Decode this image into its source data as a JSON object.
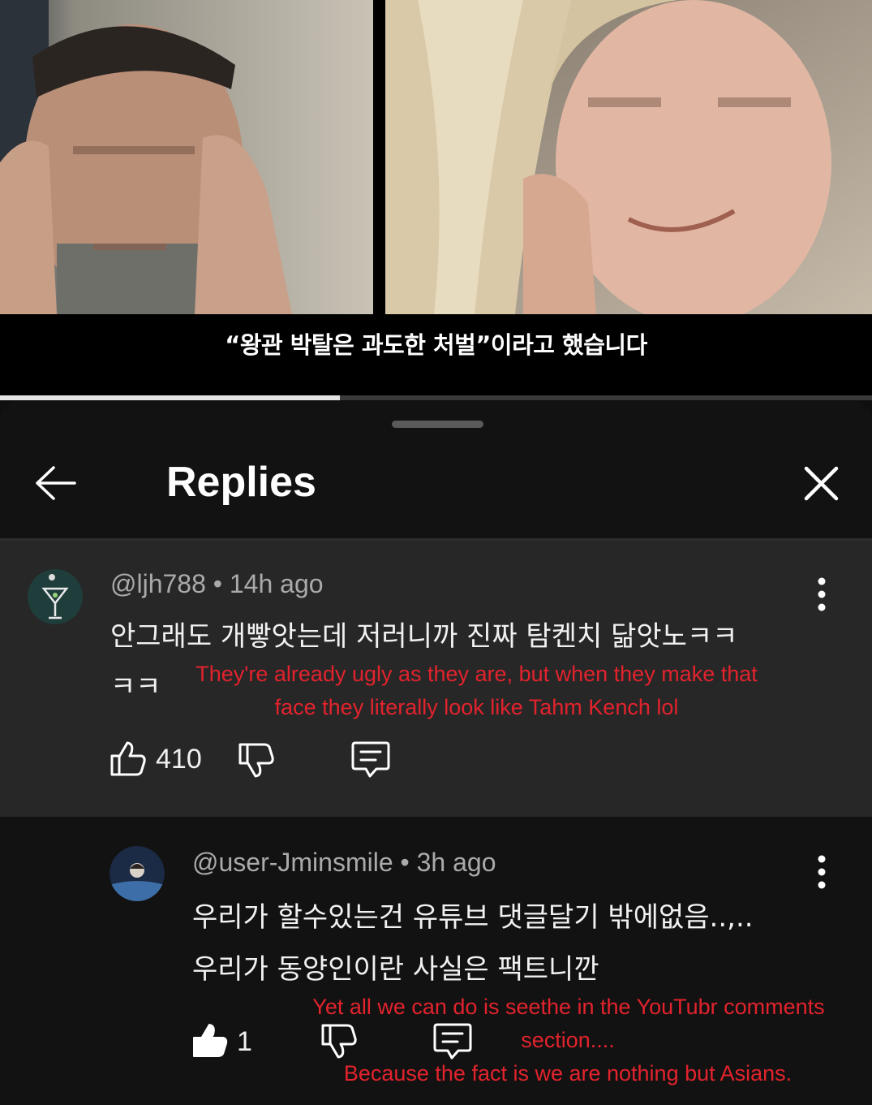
{
  "video": {
    "subtitle": "“왕관 박탈은 과도한 처벌”이라고 했습니다",
    "progress": 0.39
  },
  "panel": {
    "title": "Replies",
    "back_icon": "arrow-left-icon",
    "close_icon": "close-icon"
  },
  "comments": [
    {
      "handle": "@ljh788",
      "time": "14h ago",
      "lines": [
        "안그래도 개빻앗는데 저러니까 진짜 탐켄치 닮앗노ㅋㅋ",
        "ㅋㅋ"
      ],
      "translation": [
        "They're already ugly as they are, but when they make that",
        "face they literally look like Tahm Kench lol"
      ],
      "likes": "410"
    },
    {
      "handle": "@user-Jminsmile",
      "time": "3h ago",
      "lines": [
        "우리가 할수있는건 유튜브 댓글달기 밖에없음..,..",
        "우리가 동양인이란 사실은 팩트니깐"
      ],
      "translation": [
        "Yet all we can do is seethe in the YouTubr comments",
        "section....",
        "Because the fact is we are nothing but Asians."
      ],
      "likes": "1"
    }
  ],
  "colors": {
    "background": "#0f0f0f",
    "highlighted_comment": "#272727",
    "translation_text": "#e2232d"
  }
}
